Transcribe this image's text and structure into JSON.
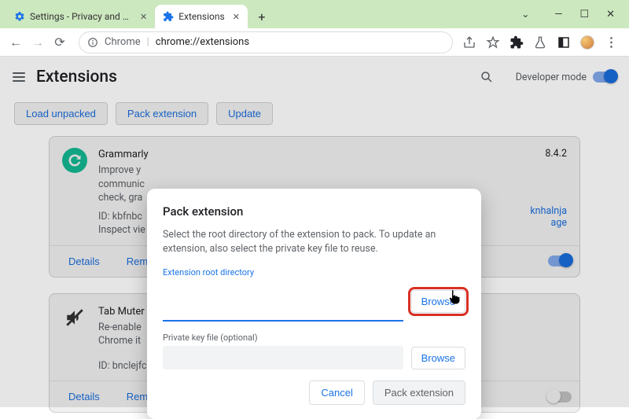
{
  "tabs": [
    {
      "label": "Settings - Privacy and security"
    },
    {
      "label": "Extensions"
    }
  ],
  "omnibox": {
    "product": "Chrome",
    "url": "chrome://extensions"
  },
  "header": {
    "title": "Extensions",
    "dev_mode_label": "Developer mode"
  },
  "actions": {
    "load_unpacked": "Load unpacked",
    "pack_extension": "Pack extension",
    "update": "Update"
  },
  "cards": [
    {
      "name": "Grammarly",
      "version_partial": "8.4.2",
      "desc1": "Improve y",
      "desc2": "communic",
      "desc3": "check, gra",
      "id_partial": "ID: kbfnbc",
      "inspect_label": "Inspect vie",
      "side_text_1": "knhalnja",
      "side_text_2": "age",
      "details": "Details",
      "remove": "Remove"
    },
    {
      "name": "Tab Muter",
      "desc1": "Re-enable",
      "desc2": "Chrome it",
      "id": "ID: bnclejfcblondkjliiblkojdeloomadd",
      "details": "Details",
      "remove": "Remove"
    }
  ],
  "dialog": {
    "title": "Pack extension",
    "body": "Select the root directory of the extension to pack. To update an extension, also select the private key file to reuse.",
    "root_label": "Extension root directory",
    "key_label": "Private key file (optional)",
    "browse": "Browse",
    "cancel": "Cancel",
    "submit": "Pack extension"
  }
}
